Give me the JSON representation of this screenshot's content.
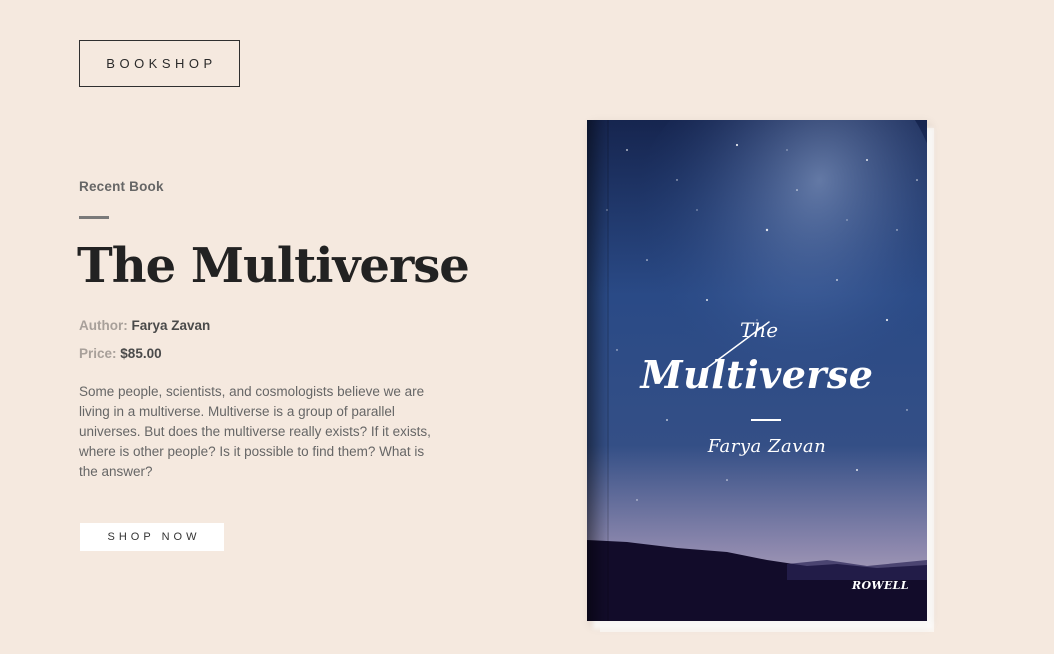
{
  "brand": {
    "logo_text": "BOOKSHOP"
  },
  "hero": {
    "eyebrow": "Recent Book",
    "title": "The Multiverse",
    "author_label": "Author:",
    "author_value": "Farya Zavan",
    "price_label": "Price:",
    "price_value": "$85.00",
    "description": "Some people, scientists, and cosmologists believe we are living in a multiverse. Multiverse is a group of parallel universes. But does the multiverse really exists? If it exists, where is other people? Is it possible to find them? What is the answer?",
    "cta_label": "SHOP NOW"
  },
  "book_cover": {
    "the": "The",
    "title": "Multiverse",
    "author": "Farya Zavan",
    "publisher": "ROWELL"
  },
  "colors": {
    "background": "#f5e9df",
    "title_text": "#222222",
    "cover_sky_top": "#1c2d5c",
    "cover_sky_bottom": "#c7b6c9",
    "cover_ground": "#120c2a"
  }
}
